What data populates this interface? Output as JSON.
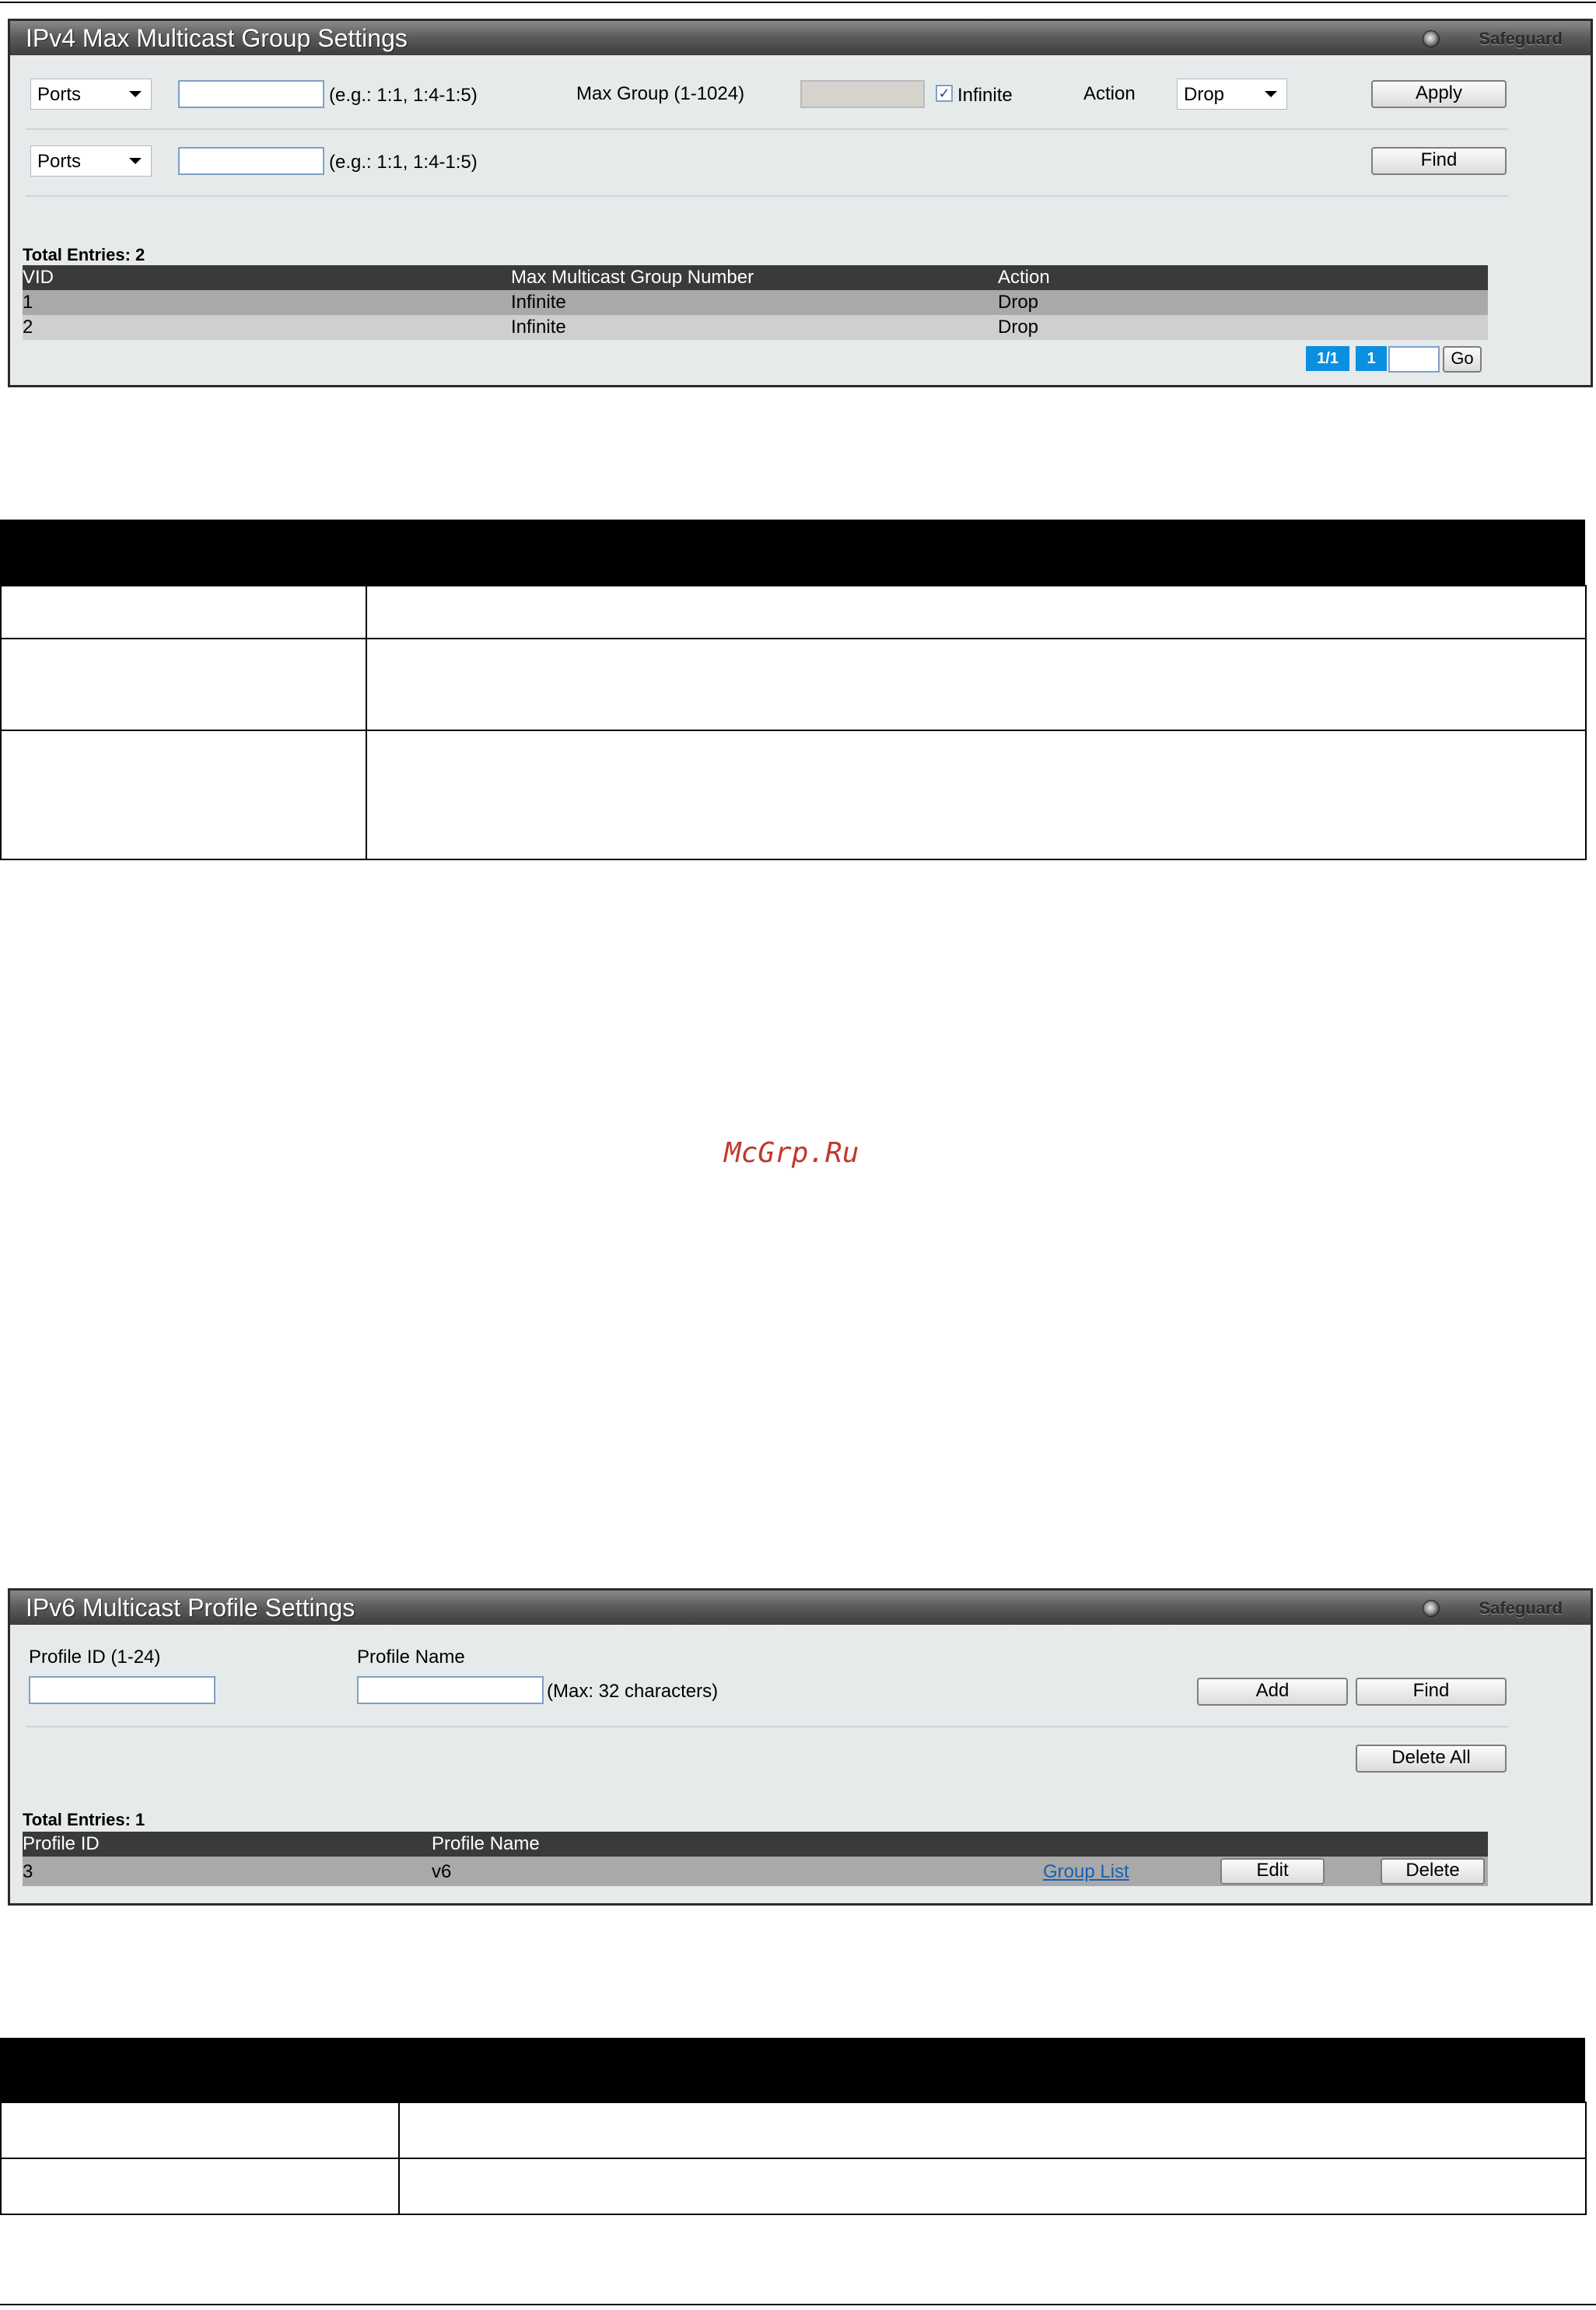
{
  "panel1": {
    "title": "IPv4 Max Multicast Group Settings",
    "safeguard": "Safeguard",
    "row1": {
      "select_value": "Ports",
      "hint": "(e.g.: 1:1, 1:4-1:5)",
      "max_group_label": "Max Group (1-1024)",
      "infinite_label": "Infinite",
      "infinite_checked": true,
      "action_label": "Action",
      "action_value": "Drop",
      "apply_label": "Apply"
    },
    "row2": {
      "select_value": "Ports",
      "hint": "(e.g.: 1:1, 1:4-1:5)",
      "find_label": "Find"
    },
    "total_entries": "Total Entries: 2",
    "table": {
      "headers": [
        "VID",
        "Max Multicast Group Number",
        "Action"
      ],
      "rows": [
        [
          "1",
          "Infinite",
          "Drop"
        ],
        [
          "2",
          "Infinite",
          "Drop"
        ]
      ]
    },
    "pagination": {
      "page_of": "1/1",
      "page": "1",
      "go_label": "Go"
    }
  },
  "watermark": "McGrp.Ru",
  "panel2": {
    "title": "IPv6 Multicast Profile Settings",
    "safeguard": "Safeguard",
    "profile_id_label": "Profile ID (1-24)",
    "profile_name_label": "Profile Name",
    "max_hint": "(Max: 32 characters)",
    "add_label": "Add",
    "find_label": "Find",
    "delete_all_label": "Delete All",
    "total_entries": "Total Entries: 1",
    "table": {
      "headers": [
        "Profile ID",
        "Profile Name"
      ],
      "rows": [
        {
          "id": "3",
          "name": "v6",
          "group_list": "Group List",
          "edit": "Edit",
          "delete": "Delete"
        }
      ]
    }
  }
}
